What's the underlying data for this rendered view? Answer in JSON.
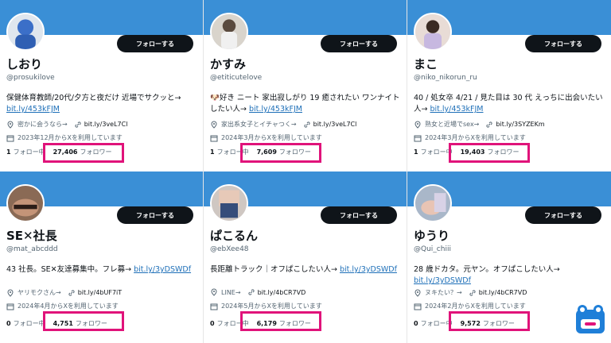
{
  "cards": [
    {
      "name": "しおり",
      "handle": "@prosukilove",
      "bio_text": "保健体育教師/20代/夕方と夜だけ 近場でサクッと→",
      "bio_link": "bit.ly/453kFJM",
      "location": "密かに会うなら→",
      "url": "bit.ly/3veL7Cl",
      "joined": "2023年12月からXを利用しています",
      "following": "1",
      "following_label": "フォロー中",
      "followers": "27,406",
      "followers_label": "フォロワー",
      "follow_btn": "フォローする"
    },
    {
      "name": "かすみ",
      "handle": "@etiticutelove",
      "bio_text": "🐶好き ニート 家出寂しがり 19 癒されたい ワンナイトしたい人→",
      "bio_link": "bit.ly/453kFJM",
      "location": "家出系女子とイチャつく→",
      "url": "bit.ly/3veL7Cl",
      "joined": "2024年3月からXを利用しています",
      "following": "1",
      "following_label": "フォロー中",
      "followers": "7,609",
      "followers_label": "フォロワー",
      "follow_btn": "フォローする"
    },
    {
      "name": "まこ",
      "handle": "@niko_nikorun_ru",
      "bio_text": "40 / 処女卒 4/21 / 見た目は 30 代 えっちに出会いたい人→",
      "bio_link": "bit.ly/453kFJM",
      "location": "熟女と近場でsex→",
      "url": "bit.ly/3SYZEKm",
      "joined": "2024年3月からXを利用しています",
      "following": "1",
      "following_label": "フォロー中",
      "followers": "19,403",
      "followers_label": "フォロワー",
      "follow_btn": "フォローする"
    },
    {
      "name": "SE✕社長",
      "handle": "@mat_abcddd",
      "bio_text": "43 社長。SE✕友達募集中。フレ募→",
      "bio_link": "bit.ly/3yDSWDf",
      "location": "ヤリモクさん→",
      "url": "bit.ly/4bUF7iT",
      "joined": "2024年4月からXを利用しています",
      "following": "0",
      "following_label": "フォロー中",
      "followers": "4,751",
      "followers_label": "フォロワー",
      "follow_btn": "フォローする"
    },
    {
      "name": "ぱこるん",
      "handle": "@ebXee48",
      "bio_text": "長距離トラック｜オフぱこしたい人→",
      "bio_link": "bit.ly/3yDSWDf",
      "location": "LINE→",
      "url": "bit.ly/4bCR7VD",
      "joined": "2024年5月からXを利用しています",
      "following": "0",
      "following_label": "フォロー中",
      "followers": "6,179",
      "followers_label": "フォロワー",
      "follow_btn": "フォローする"
    },
    {
      "name": "ゆうり",
      "handle": "@Qui_chiii",
      "bio_text": "28 歳ドカタ。元ヤン。オフぱこしたい人→",
      "bio_link": "bit.ly/3yDSWDf",
      "location": "ヌキたい？→",
      "url": "bit.ly/4bCR7VD",
      "joined": "2024年2月からXを利用しています",
      "following": "0",
      "following_label": "フォロー中",
      "followers": "9,572",
      "followers_label": "フォロワー",
      "follow_btn": "フォローする"
    }
  ],
  "colors": {
    "banner": "#3a8fd6",
    "highlight": "#e0137a",
    "button": "#0f1419",
    "link": "#1d6fb8"
  },
  "icons": [
    "location-icon",
    "link-icon",
    "calendar-icon",
    "mascot-icon"
  ]
}
